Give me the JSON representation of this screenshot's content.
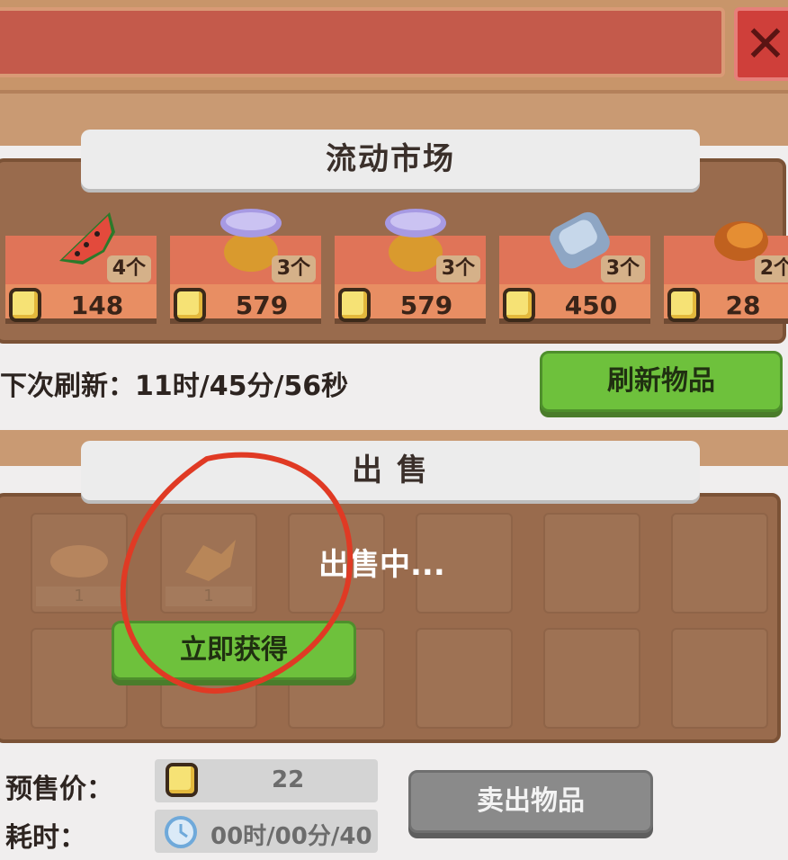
{
  "header": {
    "close_icon": "close-x-icon"
  },
  "market": {
    "title": "流动市场",
    "items": [
      {
        "icon": "watermelon-icon",
        "qty": "4个",
        "price": "148"
      },
      {
        "icon": "honey-jar-icon",
        "qty": "3个",
        "price": "579"
      },
      {
        "icon": "honey-jar-icon",
        "qty": "3个",
        "price": "579"
      },
      {
        "icon": "ice-block-icon",
        "qty": "3个",
        "price": "450"
      },
      {
        "icon": "bread-icon",
        "qty": "2个",
        "price": "28"
      }
    ],
    "next_refresh": "下次刷新：11时/45分/56秒",
    "refresh_button": "刷新物品"
  },
  "sell": {
    "title": "出  售",
    "status": "出售中...",
    "cells": [
      {
        "icon": "bread-icon",
        "count": "1"
      },
      {
        "icon": "ginger-icon",
        "count": "1"
      }
    ],
    "instant_button": "立即获得",
    "presale_label": "预售价：",
    "presale_value": "22",
    "time_label": "耗时：",
    "time_value": "00时/00分/40",
    "sell_button": "卖出物品"
  },
  "colors": {
    "title_bar": "#c45a4b",
    "panel": "#996b4d",
    "green_button": "#6ec13c",
    "annotation": "#e03a24"
  }
}
